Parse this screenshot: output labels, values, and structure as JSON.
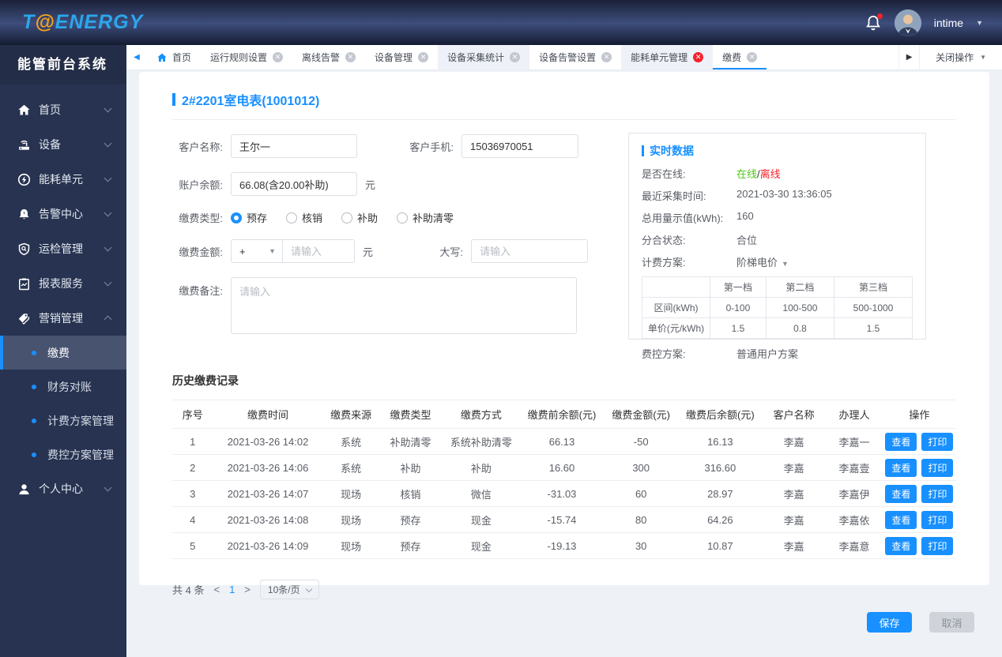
{
  "brand": {
    "logo_t": "T",
    "logo_at": "@",
    "logo_energy": "ENERGY"
  },
  "topbar": {
    "username": "intime"
  },
  "sidebar": {
    "title": "能管前台系统",
    "items": [
      {
        "label": "首页"
      },
      {
        "label": "设备"
      },
      {
        "label": "能耗单元"
      },
      {
        "label": "告警中心"
      },
      {
        "label": "运检管理"
      },
      {
        "label": "报表服务"
      },
      {
        "label": "营销管理"
      },
      {
        "label": "个人中心"
      }
    ],
    "submenu": [
      {
        "label": "缴费"
      },
      {
        "label": "财务对账"
      },
      {
        "label": "计费方案管理"
      },
      {
        "label": "费控方案管理"
      }
    ],
    "active_submenu": "缴费"
  },
  "tabbar": {
    "home": "首页",
    "tabs": [
      {
        "label": "运行规则设置",
        "tinted": false,
        "close": "gray",
        "active": false
      },
      {
        "label": "离线告警",
        "tinted": false,
        "close": "gray",
        "active": false
      },
      {
        "label": "设备管理",
        "tinted": false,
        "close": "gray",
        "active": false
      },
      {
        "label": "设备采集统计",
        "tinted": true,
        "close": "gray",
        "active": false
      },
      {
        "label": "设备告警设置",
        "tinted": false,
        "close": "gray",
        "active": false
      },
      {
        "label": "能耗单元管理",
        "tinted": true,
        "close": "red",
        "active": false
      },
      {
        "label": "缴费",
        "tinted": false,
        "close": "gray",
        "active": true
      }
    ],
    "close_menu": "关闭操作"
  },
  "page": {
    "title": "2#2201室电表(1001012)"
  },
  "form": {
    "customer_name_label": "客户名称:",
    "customer_name": "王尔一",
    "customer_phone_label": "客户手机:",
    "customer_phone": "15036970051",
    "balance_label": "账户余额:",
    "balance": "66.08(含20.00补助)",
    "unit_yuan": "元",
    "pay_type_label": "缴费类型:",
    "pay_types": [
      "预存",
      "核销",
      "补助",
      "补助清零"
    ],
    "pay_type_selected": "预存",
    "amount_label": "缴费金额:",
    "amount_sign": "+",
    "amount_placeholder": "请输入",
    "uppercase_label": "大写:",
    "uppercase_placeholder": "请输入",
    "remark_label": "缴费备注:",
    "remark_placeholder": "请输入"
  },
  "realtime": {
    "title": "实时数据",
    "online_label": "是否在线:",
    "online": "在线",
    "slash": "/",
    "offline": "离线",
    "collect_time_label": "最近采集时间:",
    "collect_time": "2021-03-30 13:36:05",
    "total_usage_label": "总用量示值(kWh):",
    "total_usage": "160",
    "switch_state_label": "分合状态:",
    "switch_state": "合位",
    "billing_plan_label": "计费方案:",
    "billing_plan": "阶梯电价",
    "tier_table": {
      "headers": [
        "",
        "第一档",
        "第二档",
        "第三档"
      ],
      "rows": [
        [
          "区间(kWh)",
          "0-100",
          "100-500",
          "500-1000"
        ],
        [
          "单价(元/kWh)",
          "1.5",
          "0.8",
          "1.5"
        ]
      ]
    },
    "fee_plan_label": "费控方案:",
    "fee_plan": "普通用户方案"
  },
  "history": {
    "title": "历史缴费记录",
    "columns": [
      "序号",
      "缴费时间",
      "缴费来源",
      "缴费类型",
      "缴费方式",
      "缴费前余额(元)",
      "缴费金额(元)",
      "缴费后余额(元)",
      "客户名称",
      "办理人",
      "操作"
    ],
    "rows": [
      [
        "1",
        "2021-03-26 14:02",
        "系统",
        "补助清零",
        "系统补助清零",
        "66.13",
        "-50",
        "16.13",
        "李嘉",
        "李嘉一"
      ],
      [
        "2",
        "2021-03-26 14:06",
        "系统",
        "补助",
        "补助",
        "16.60",
        "300",
        "316.60",
        "李嘉",
        "李嘉壹"
      ],
      [
        "3",
        "2021-03-26 14:07",
        "现场",
        "核销",
        "微信",
        "-31.03",
        "60",
        "28.97",
        "李嘉",
        "李嘉伊"
      ],
      [
        "4",
        "2021-03-26 14:08",
        "现场",
        "预存",
        "现金",
        "-15.74",
        "80",
        "64.26",
        "李嘉",
        "李嘉依"
      ],
      [
        "5",
        "2021-03-26 14:09",
        "现场",
        "预存",
        "现金",
        "-19.13",
        "30",
        "10.87",
        "李嘉",
        "李嘉意"
      ]
    ],
    "view_btn": "查看",
    "print_btn": "打印"
  },
  "pagination": {
    "total_text": "共 4 条",
    "prev": "<",
    "current_page": "1",
    "next": ">",
    "page_size": "10条/页"
  },
  "actions": {
    "save": "保存",
    "cancel": "取消"
  },
  "colors": {
    "accent": "#1890ff",
    "online_green": "#52c41a",
    "offline_red": "#f5222d",
    "topbar_navy": "#3e4d7c"
  }
}
